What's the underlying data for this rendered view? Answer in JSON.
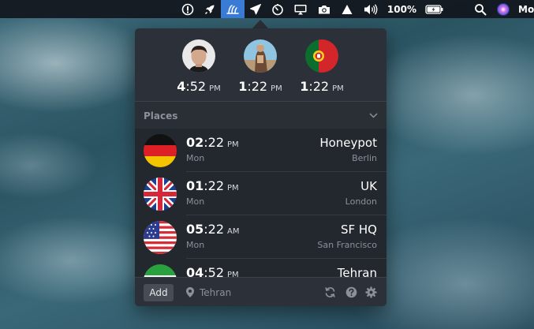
{
  "menubar": {
    "battery": "100%",
    "truncated_app": "Mo",
    "icons": [
      "info-icon",
      "rocket-icon",
      "there-app-icon",
      "paper-plane-icon",
      "timer-icon",
      "airplay-display-icon",
      "camera-icon",
      "triangle-icon",
      "volume-icon",
      "battery-icon",
      "spotlight-search-icon",
      "siri-icon"
    ]
  },
  "people": [
    {
      "hour": "4",
      "minutes": ":52",
      "ampm": "PM"
    },
    {
      "hour": "1",
      "minutes": ":22",
      "ampm": "PM"
    },
    {
      "hour": "1",
      "minutes": ":22",
      "ampm": "PM"
    }
  ],
  "places": {
    "title": "Places",
    "rows": [
      {
        "hour": "02",
        "minutes": ":22",
        "ampm": "PM",
        "day": "Mon",
        "name": "Honeypot",
        "city": "Berlin",
        "flag": "germany-flag"
      },
      {
        "hour": "01",
        "minutes": ":22",
        "ampm": "PM",
        "day": "Mon",
        "name": "UK",
        "city": "London",
        "flag": "uk-flag"
      },
      {
        "hour": "05",
        "minutes": ":22",
        "ampm": "AM",
        "day": "Mon",
        "name": "SF HQ",
        "city": "San Francisco",
        "flag": "usa-flag"
      },
      {
        "hour": "04",
        "minutes": ":52",
        "ampm": "PM",
        "day": "",
        "name": "Tehran",
        "city": "",
        "flag": "iran-flag"
      }
    ]
  },
  "footer": {
    "add_label": "Add",
    "location": "Tehran"
  },
  "colors": {
    "menubar_active": "#3a7bd5",
    "popover_bg": "#2c3038",
    "list_bg": "#23272e",
    "muted_text": "#8c9199"
  }
}
